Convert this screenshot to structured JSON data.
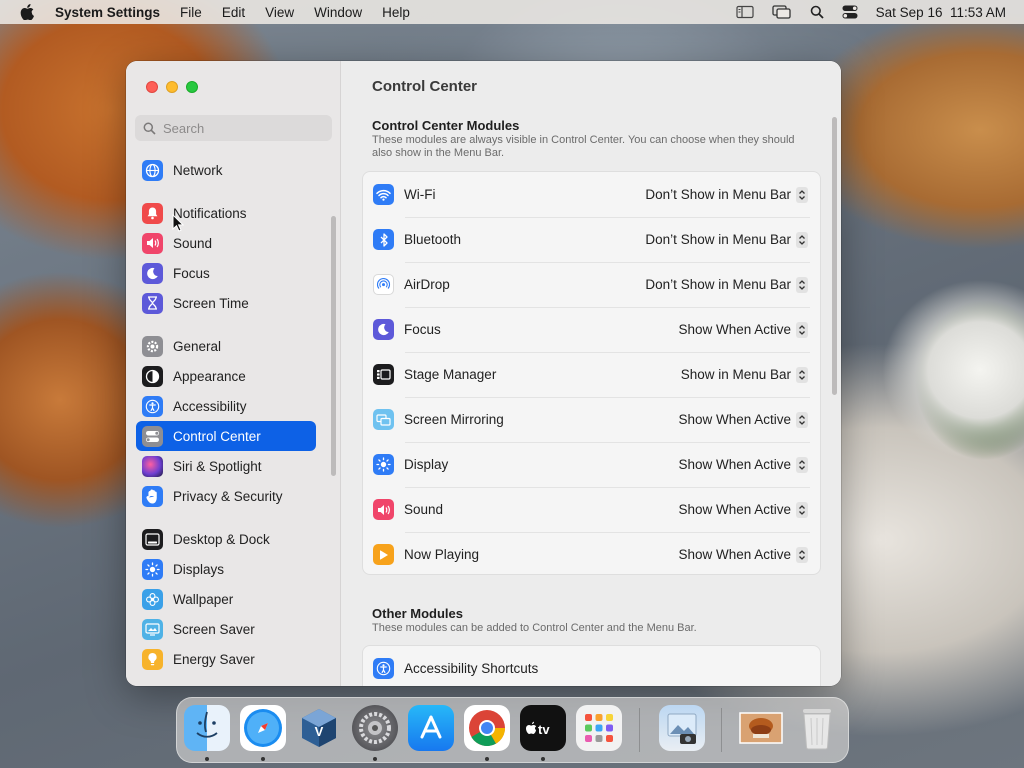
{
  "menubar": {
    "app_name": "System Settings",
    "menus": [
      "File",
      "Edit",
      "View",
      "Window",
      "Help"
    ],
    "datetime": "Sat Sep 16  11:53 AM"
  },
  "window": {
    "title": "Control Center"
  },
  "search": {
    "placeholder": "Search"
  },
  "sidebar": {
    "items": [
      {
        "label": "Network",
        "icon": "globe-icon",
        "color": "#2f7cf6"
      },
      {
        "label": "Notifications",
        "icon": "bell-icon",
        "color": "#f04a4a"
      },
      {
        "label": "Sound",
        "icon": "speaker-icon",
        "color": "#f0456a"
      },
      {
        "label": "Focus",
        "icon": "moon-icon",
        "color": "#5d59d9"
      },
      {
        "label": "Screen Time",
        "icon": "hourglass-icon",
        "color": "#5d59d9"
      },
      {
        "label": "General",
        "icon": "gear-icon",
        "color": "#8e8e93"
      },
      {
        "label": "Appearance",
        "icon": "appearance-icon",
        "color": "#1c1c1e"
      },
      {
        "label": "Accessibility",
        "icon": "accessibility-icon",
        "color": "#2f7cf6"
      },
      {
        "label": "Control Center",
        "icon": "control-center-icon",
        "color": "#8e8e93"
      },
      {
        "label": "Siri & Spotlight",
        "icon": "siri-icon",
        "color": "#6e3fd1"
      },
      {
        "label": "Privacy & Security",
        "icon": "hand-icon",
        "color": "#2f7cf6"
      },
      {
        "label": "Desktop & Dock",
        "icon": "dock-icon",
        "color": "#1c1c1e"
      },
      {
        "label": "Displays",
        "icon": "sun-icon",
        "color": "#2f7cf6"
      },
      {
        "label": "Wallpaper",
        "icon": "flower-icon",
        "color": "#3aa0e8"
      },
      {
        "label": "Screen Saver",
        "icon": "screensaver-icon",
        "color": "#4fb2e6"
      },
      {
        "label": "Energy Saver",
        "icon": "bulb-icon",
        "color": "#f7b32b"
      }
    ],
    "selected": "Control Center"
  },
  "content": {
    "section1": {
      "title": "Control Center Modules",
      "description": "These modules are always visible in Control Center. You can choose when they should also show in the Menu Bar."
    },
    "modules": [
      {
        "label": "Wi-Fi",
        "option": "Don’t Show in Menu Bar",
        "icon": "wifi-icon",
        "color": "#2f7cf6"
      },
      {
        "label": "Bluetooth",
        "option": "Don’t Show in Menu Bar",
        "icon": "bluetooth-icon",
        "color": "#2f7cf6"
      },
      {
        "label": "AirDrop",
        "option": "Don’t Show in Menu Bar",
        "icon": "airdrop-icon",
        "color": "#ffffff"
      },
      {
        "label": "Focus",
        "option": "Show When Active",
        "icon": "moon-icon",
        "color": "#5d59d9"
      },
      {
        "label": "Stage Manager",
        "option": "Show in Menu Bar",
        "icon": "stage-manager-icon",
        "color": "#1c1c1e"
      },
      {
        "label": "Screen Mirroring",
        "option": "Show When Active",
        "icon": "screen-mirroring-icon",
        "color": "#6fc2f0"
      },
      {
        "label": "Display",
        "option": "Show When Active",
        "icon": "sun-icon",
        "color": "#2f7cf6"
      },
      {
        "label": "Sound",
        "option": "Show When Active",
        "icon": "speaker-icon",
        "color": "#f0456a"
      },
      {
        "label": "Now Playing",
        "option": "Show When Active",
        "icon": "play-icon",
        "color": "#f7a21b"
      }
    ],
    "section2": {
      "title": "Other Modules",
      "description": "These modules can be added to Control Center and the Menu Bar."
    },
    "other_modules": [
      {
        "label": "Accessibility Shortcuts",
        "icon": "accessibility-icon",
        "color": "#2f7cf6"
      }
    ]
  },
  "dock": {
    "apps": [
      {
        "name": "Finder",
        "icon": "finder-icon",
        "running": true
      },
      {
        "name": "Safari",
        "icon": "safari-icon",
        "running": true
      },
      {
        "name": "VirtualBox",
        "icon": "virtualbox-icon",
        "running": false
      },
      {
        "name": "System Settings",
        "icon": "system-settings-icon",
        "running": true
      },
      {
        "name": "App Store",
        "icon": "app-store-icon",
        "running": false
      },
      {
        "name": "Chrome",
        "icon": "chrome-icon",
        "running": true
      },
      {
        "name": "Apple TV",
        "icon": "apple-tv-icon",
        "running": true
      },
      {
        "name": "Launchpad",
        "icon": "launchpad-icon",
        "running": false
      },
      {
        "name": "Preview",
        "icon": "preview-icon",
        "running": false
      },
      {
        "name": "Wallpaper Image",
        "icon": "image-thumbnail-icon",
        "running": false
      },
      {
        "name": "Trash",
        "icon": "trash-icon",
        "running": false
      }
    ]
  }
}
